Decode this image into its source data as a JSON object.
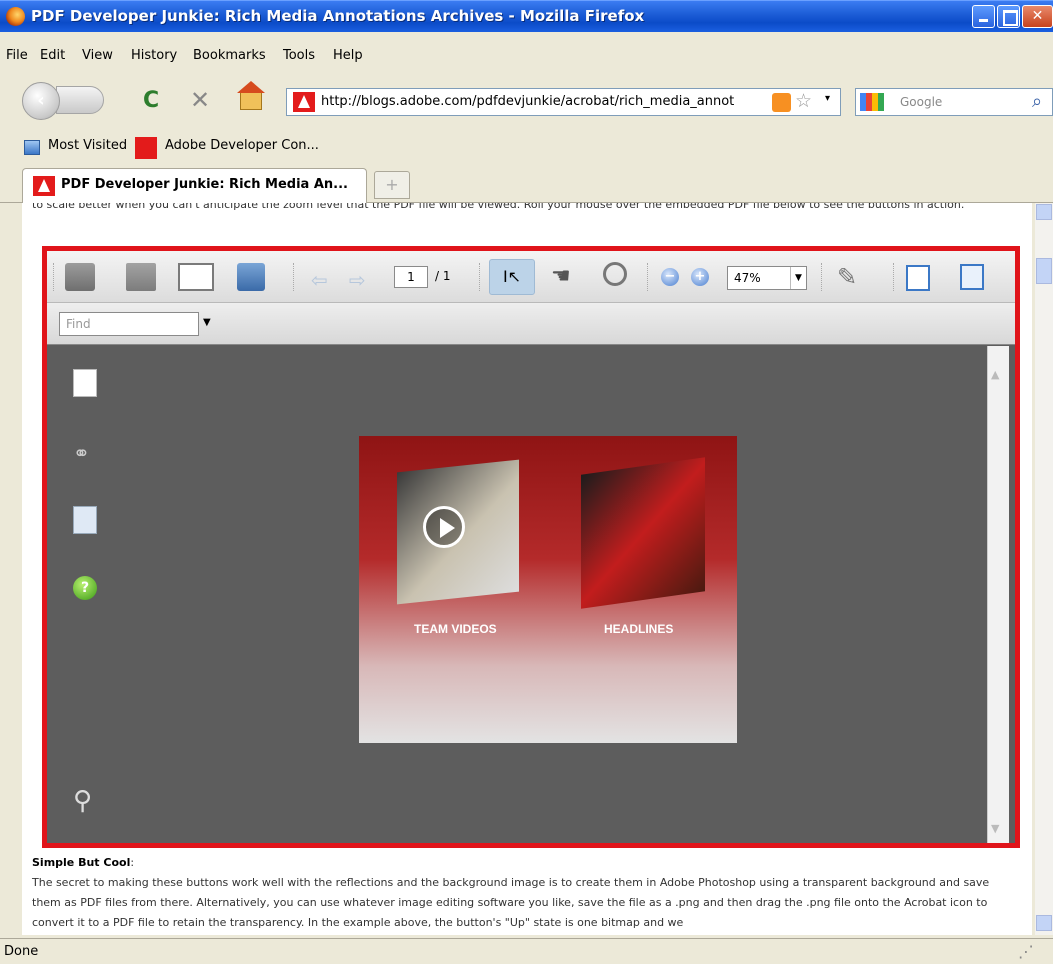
{
  "window": {
    "title": "PDF Developer Junkie: Rich Media Annotations Archives - Mozilla Firefox"
  },
  "menu": [
    "File",
    "Edit",
    "View",
    "History",
    "Bookmarks",
    "Tools",
    "Help"
  ],
  "navigation": {
    "url": "http://blogs.adobe.com/pdfdevjunkie/acrobat/rich_media_annot",
    "search_placeholder": "Google"
  },
  "bookmarks": [
    "Most Visited",
    "Adobe Developer Con..."
  ],
  "tab": {
    "label": "PDF Developer Junkie: Rich Media An...",
    "new_tab": "+"
  },
  "article": {
    "intro": "to scale better when you can't anticipate the zoom level that the PDF file will be viewed. Roll your mouse over the embedded PDF file below to see the buttons in action.",
    "section_heading": "Simple But Cool",
    "section_colon": ":",
    "section_body": "The secret to making these buttons work well with the reflections and the background image is to create them in Adobe Photoshop using a transparent background and save them as PDF files from there. Alternatively, you can use whatever image editing software you like, save the file as a .png and then drag the .png file onto the Acrobat icon to convert it to a PDF file to retain the transparency. In the example above, the button's \"Up\" state is one bitmap and we"
  },
  "pdf_viewer": {
    "page_current": "1",
    "page_total": "/ 1",
    "zoom": "47%",
    "find_placeholder": "Find",
    "card": {
      "button1_label": "TEAM VIDEOS",
      "button2_label": "HEADLINES"
    }
  },
  "status": {
    "text": "Done"
  },
  "colors": {
    "pdf_border": "#e0141a",
    "titlebar": "#1e5fd8"
  }
}
